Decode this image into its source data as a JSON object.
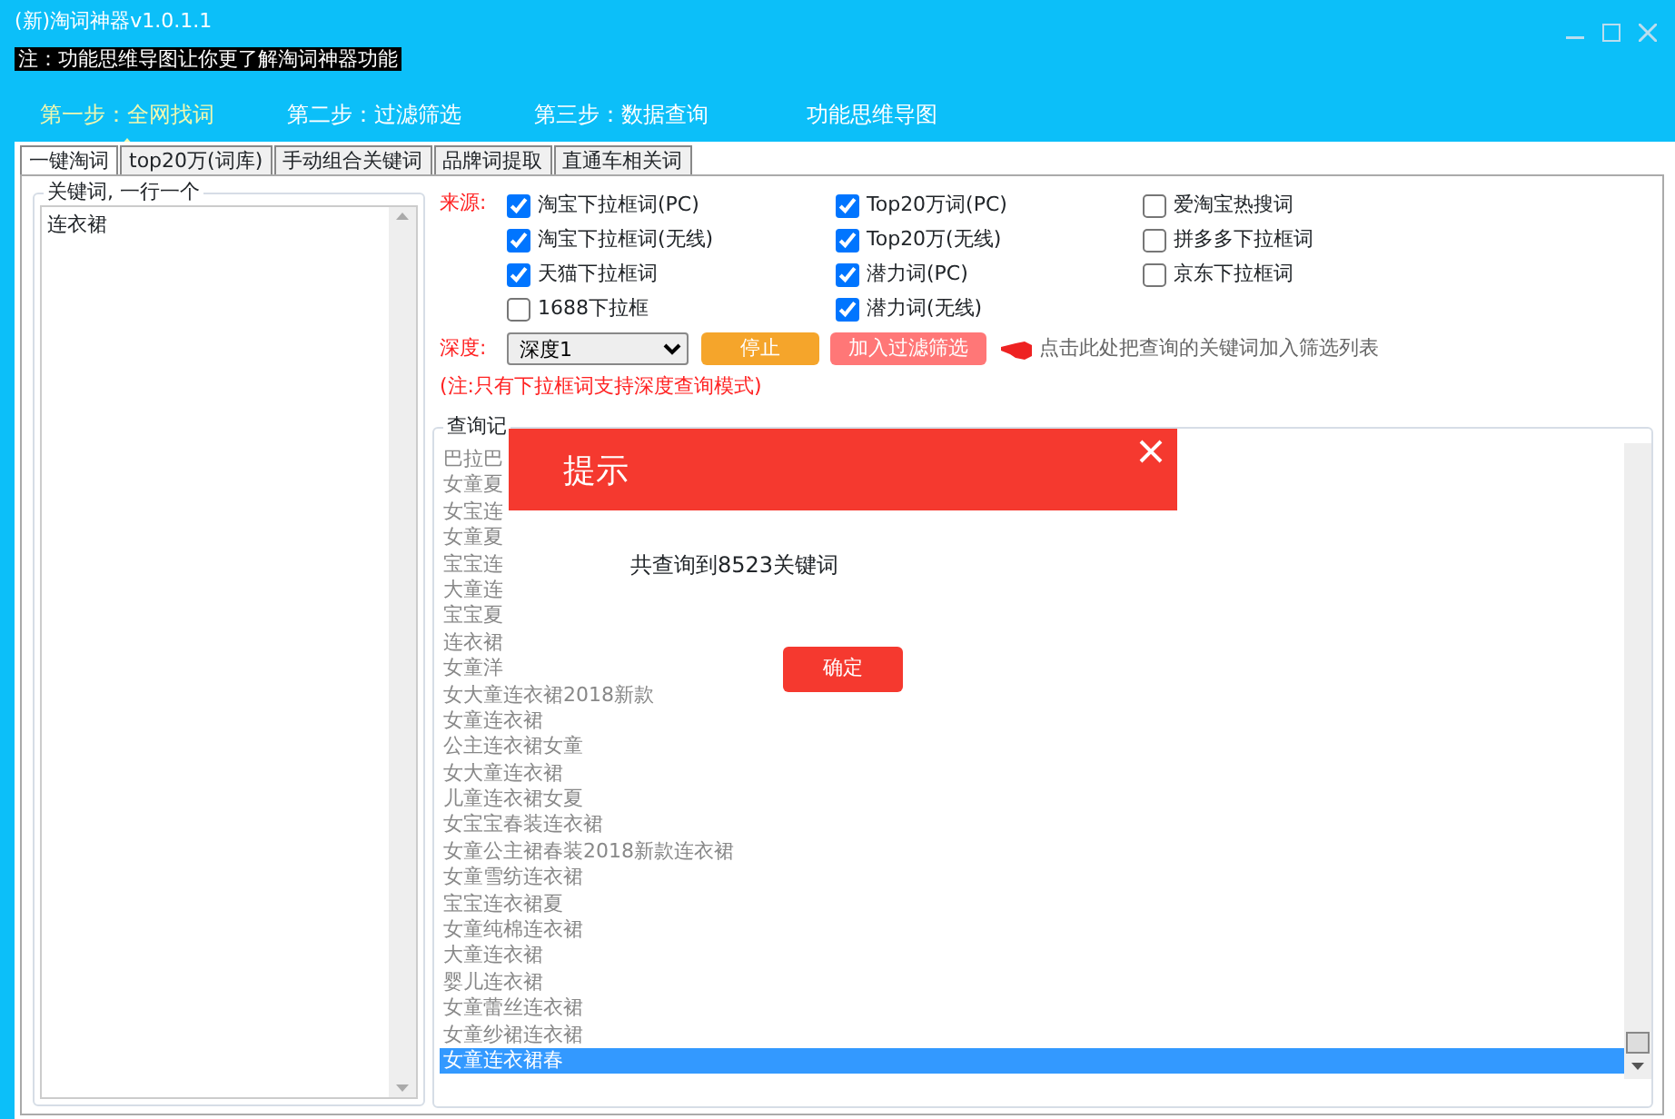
{
  "window": {
    "title": "(新)淘词神器v1.0.1.1",
    "notice": "注：功能思维导图让你更了解淘词神器功能"
  },
  "steps": [
    {
      "label": "第一步：全网找词",
      "selected": true
    },
    {
      "label": "第二步：过滤筛选",
      "selected": false
    },
    {
      "label": "第三步：数据查询",
      "selected": false
    },
    {
      "label": "功能思维导图",
      "selected": false
    }
  ],
  "tabs": [
    {
      "label": "一键淘词",
      "selected": true
    },
    {
      "label": "top20万(词库)",
      "selected": false
    },
    {
      "label": "手动组合关键词",
      "selected": false
    },
    {
      "label": "品牌词提取",
      "selected": false
    },
    {
      "label": "直通车相关词",
      "selected": false
    }
  ],
  "keywords": {
    "legend": "关键词, 一行一个",
    "value": "连衣裙"
  },
  "sources": {
    "label": "来源:",
    "columns": [
      [
        {
          "label": "淘宝下拉框词(PC)",
          "checked": true
        },
        {
          "label": "淘宝下拉框词(无线)",
          "checked": true
        },
        {
          "label": "天猫下拉框词",
          "checked": true
        },
        {
          "label": "1688下拉框",
          "checked": false
        }
      ],
      [
        {
          "label": "Top20万词(PC)",
          "checked": true
        },
        {
          "label": "Top20万(无线)",
          "checked": true
        },
        {
          "label": "潜力词(PC)",
          "checked": true
        },
        {
          "label": "潜力词(无线)",
          "checked": true
        }
      ],
      [
        {
          "label": "爱淘宝热搜词",
          "checked": false
        },
        {
          "label": "拼多多下拉框词",
          "checked": false
        },
        {
          "label": "京东下拉框词",
          "checked": false
        }
      ]
    ]
  },
  "depth": {
    "label": "深度:",
    "value": "深度1",
    "note": "(注:只有下拉框词支持深度查询模式)"
  },
  "buttons": {
    "stop": "停止",
    "add_filter": "加入过滤筛选",
    "hint": "点击此处把查询的关键词加入筛选列表"
  },
  "records": {
    "legend": "查询记",
    "rows": [
      {
        "text": "巴拉巴",
        "selected": false
      },
      {
        "text": "女童夏",
        "selected": false
      },
      {
        "text": "女宝连",
        "selected": false
      },
      {
        "text": "女童夏",
        "selected": false
      },
      {
        "text": "宝宝连",
        "selected": false
      },
      {
        "text": "大童连",
        "selected": false
      },
      {
        "text": "宝宝夏",
        "selected": false
      },
      {
        "text": "连衣裙",
        "selected": false
      },
      {
        "text": "女童洋",
        "selected": false
      },
      {
        "text": "女大童连衣裙2018新款",
        "selected": false
      },
      {
        "text": "女童连衣裙",
        "selected": false
      },
      {
        "text": "公主连衣裙女童",
        "selected": false
      },
      {
        "text": "女大童连衣裙",
        "selected": false
      },
      {
        "text": "儿童连衣裙女夏",
        "selected": false
      },
      {
        "text": "女宝宝春装连衣裙",
        "selected": false
      },
      {
        "text": "女童公主裙春装2018新款连衣裙",
        "selected": false
      },
      {
        "text": "女童雪纺连衣裙",
        "selected": false
      },
      {
        "text": "宝宝连衣裙夏",
        "selected": false
      },
      {
        "text": "女童纯棉连衣裙",
        "selected": false
      },
      {
        "text": "大童连衣裙",
        "selected": false
      },
      {
        "text": "婴儿连衣裙",
        "selected": false
      },
      {
        "text": "女童蕾丝连衣裙",
        "selected": false
      },
      {
        "text": "女童纱裙连衣裙",
        "selected": false
      },
      {
        "text": "女童连衣裙春",
        "selected": true
      }
    ]
  },
  "dialog": {
    "title": "提示",
    "message": "共查询到8523关键词",
    "ok": "确定"
  }
}
